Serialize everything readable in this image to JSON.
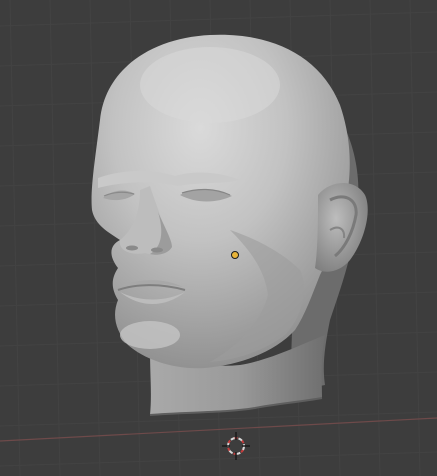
{
  "viewport": {
    "background_color": "#3d3d3d",
    "grid_line_color": "#434343",
    "x_axis_color": "#6e4a4a",
    "mesh_color": "#b5b5b5",
    "origin_dot_color": "#e8b43a",
    "cursor_color": "#d8d8d8",
    "cursor_accent_color": "#c43c3c"
  },
  "scene": {
    "object_icon": "sculpted-head-mesh",
    "origin_icon": "object-origin-dot",
    "cursor_icon": "3d-cursor-icon"
  }
}
